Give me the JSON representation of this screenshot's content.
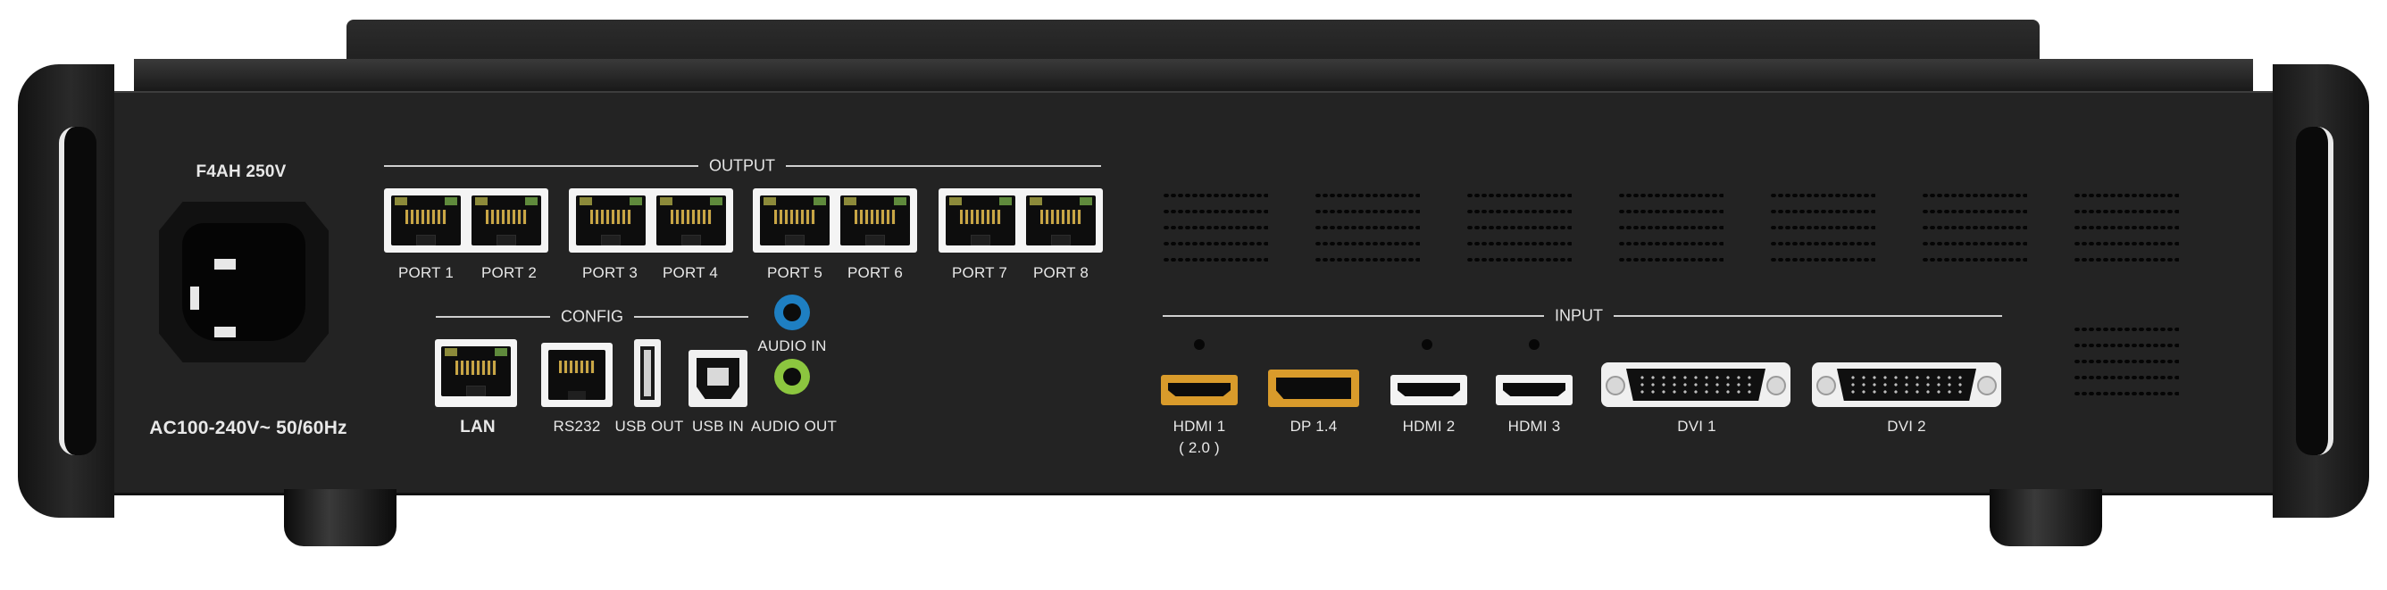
{
  "output": {
    "title": "OUTPUT",
    "ports": [
      "PORT 1",
      "PORT 2",
      "PORT 3",
      "PORT 4",
      "PORT 5",
      "PORT 6",
      "PORT 7",
      "PORT 8"
    ]
  },
  "config": {
    "title": "CONFIG",
    "lan": "LAN",
    "rs232": "RS232",
    "usb_out": "USB OUT",
    "usb_in": "USB IN",
    "audio_in": "AUDIO IN",
    "audio_out": "AUDIO OUT"
  },
  "input": {
    "title": "INPUT",
    "hdmi1": "HDMI 1",
    "hdmi1_sub": "( 2.0 )",
    "dp": "DP 1.4",
    "hdmi2": "HDMI 2",
    "hdmi3": "HDMI 3",
    "dvi1": "DVI 1",
    "dvi2": "DVI 2"
  },
  "power": {
    "fuse": "F4AH   250V",
    "rating": "AC100-240V~   50/60Hz"
  },
  "colors": {
    "chassis": "#232323",
    "label": "#e8e8e8",
    "gold_connector": "#d99b2b",
    "audio_in_ring": "#1e7fc2",
    "audio_out_ring": "#8cc63f"
  }
}
